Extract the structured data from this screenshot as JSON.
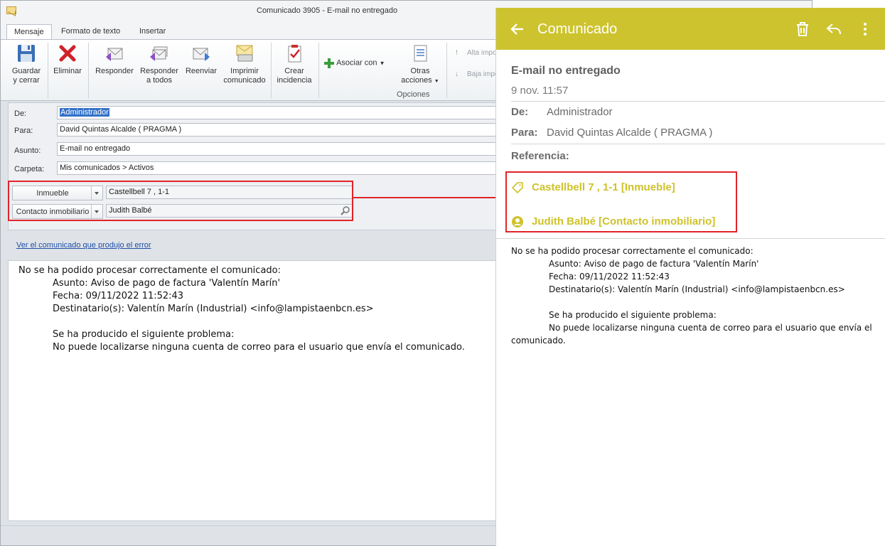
{
  "window": {
    "title": "Comunicado 3905 - E-mail no entregado",
    "tabs": [
      "Mensaje",
      "Formato de texto",
      "Insertar"
    ]
  },
  "ribbon": {
    "save": [
      "Guardar",
      "y cerrar"
    ],
    "delete": "Eliminar",
    "reply": "Responder",
    "reply_all": [
      "Responder",
      "a todos"
    ],
    "forward": "Reenviar",
    "print": [
      "Imprimir",
      "comunicado"
    ],
    "create_incident": [
      "Crear",
      "incidencia"
    ],
    "associate": "Asociar con",
    "other_actions": [
      "Otras",
      "acciones"
    ],
    "high_priority": "Alta impo",
    "low_priority": "Baja impo",
    "options_group": "Opciones"
  },
  "form": {
    "from_label": "De:",
    "from_value": "Administrador",
    "to_label": "Para:",
    "to_value": "David Quintas Alcalde ( PRAGMA )",
    "subject_label": "Asunto:",
    "subject_value": "E-mail no entregado",
    "folder_label": "Carpeta:",
    "folder_value": "Mis comunicados > Activos",
    "ref1_type": "Inmueble",
    "ref1_value": "Castellbell 7 , 1-1",
    "ref2_type": "Contacto inmobiliario",
    "ref2_value": "Judith Balbé"
  },
  "link_text": "Ver el comunicado que produjo el error",
  "body": {
    "line1": "No se ha podido procesar correctamente el comunicado:",
    "line2": "Asunto: Aviso de pago de factura 'Valentín Marín'",
    "line3": "Fecha: 09/11/2022 11:52:43",
    "line4": "Destinatario(s): Valentín Marín (Industrial) <info@lampistaenbcn.es>",
    "line5": "Se ha producido el siguiente problema:",
    "line6": "No puede localizarse ninguna cuenta de correo para el usuario que envía el comunicado."
  },
  "mobile": {
    "title": "Comunicado",
    "subject": "E-mail no entregado",
    "date": "9 nov. 11:57",
    "from_label": "De:",
    "from_value": "Administrador",
    "to_label": "Para:",
    "to_value": "David Quintas Alcalde ( PRAGMA )",
    "ref_label": "Referencia:",
    "ref1": "Castellbell 7 , 1-1 [Inmueble]",
    "ref2": "Judith Balbé [Contacto inmobiliario]",
    "body": {
      "line1": "No se ha podido procesar correctamente el comunicado:",
      "line2": "Asunto: Aviso de pago de factura 'Valentín Marín'",
      "line3": "Fecha: 09/11/2022 11:52:43",
      "line4": "Destinatario(s): Valentín Marín (Industrial) <info@lampistaenbcn.es>",
      "line5": "Se ha producido el siguiente problema:",
      "line6a": "No puede localizarse ninguna cuenta de correo para el usuario que envía el",
      "line6b": "comunicado."
    }
  },
  "colors": {
    "accent": "#cdc32e",
    "highlight": "#e0242a",
    "link": "#1f4fa8"
  }
}
